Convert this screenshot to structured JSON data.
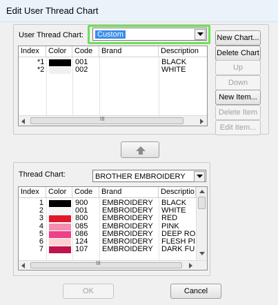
{
  "window": {
    "title": "Edit User Thread Chart"
  },
  "user_chart": {
    "label": "User Thread Chart:",
    "selected": "Custom",
    "columns": [
      "Index",
      "Color",
      "Code",
      "Brand",
      "Description"
    ],
    "rows": [
      {
        "index": "*1",
        "color": "#000000",
        "code": "001",
        "brand": "",
        "description": "BLACK"
      },
      {
        "index": "*2",
        "color": "#f0f0f0",
        "code": "002",
        "brand": "",
        "description": "WHITE"
      }
    ],
    "scroll_mark": "III"
  },
  "buttons": {
    "new_chart": "New Chart...",
    "delete_chart": "Delete Chart",
    "up": "Up",
    "down": "Down",
    "new_item": "New Item...",
    "delete_item": "Delete Item",
    "edit_item": "Edit Item...",
    "ok": "OK",
    "cancel": "Cancel"
  },
  "move_button": {
    "icon": "up-arrow-icon"
  },
  "thread_chart": {
    "label": "Thread Chart:",
    "selected": "BROTHER EMBROIDERY",
    "columns": [
      "Index",
      "Color",
      "Code",
      "Brand",
      "Descriptio"
    ],
    "rows": [
      {
        "index": "1",
        "color": "#000000",
        "code": "900",
        "brand": "EMBROIDERY",
        "description": "BLACK"
      },
      {
        "index": "2",
        "color": "#f4f4f4",
        "code": "001",
        "brand": "EMBROIDERY",
        "description": "WHITE"
      },
      {
        "index": "3",
        "color": "#e0192a",
        "code": "800",
        "brand": "EMBROIDERY",
        "description": "RED"
      },
      {
        "index": "4",
        "color": "#f58cb2",
        "code": "085",
        "brand": "EMBROIDERY",
        "description": "PINK"
      },
      {
        "index": "5",
        "color": "#ee3f89",
        "code": "086",
        "brand": "EMBROIDERY",
        "description": "DEEP RO"
      },
      {
        "index": "6",
        "color": "#fcd0d2",
        "code": "124",
        "brand": "EMBROIDERY",
        "description": "FLESH PI"
      },
      {
        "index": "7",
        "color": "#c1114f",
        "code": "107",
        "brand": "EMBROIDERY",
        "description": "DARK FU"
      }
    ],
    "scroll_mark": "III"
  },
  "colors": {
    "highlight_ring": "#6ee055",
    "selection": "#3a8de8"
  }
}
